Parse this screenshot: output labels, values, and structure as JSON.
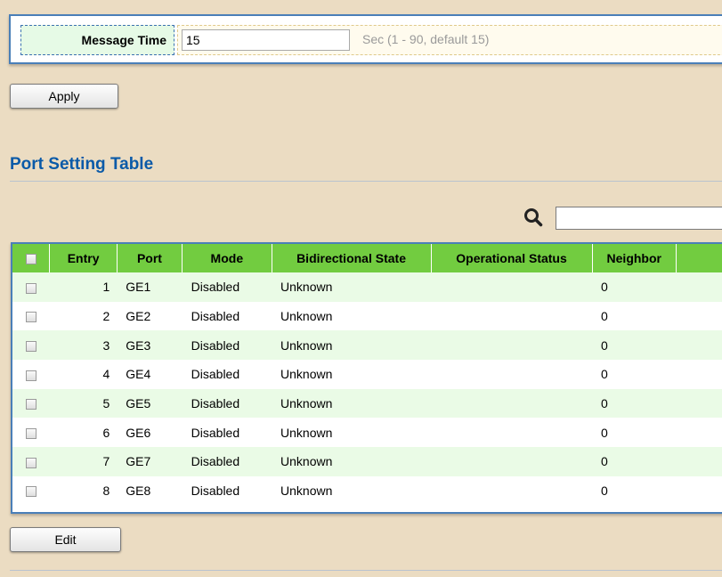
{
  "message_time": {
    "label": "Message Time",
    "value": "15",
    "hint": "Sec (1 - 90, default 15)"
  },
  "buttons": {
    "apply": "Apply",
    "edit": "Edit"
  },
  "port_table": {
    "title": "Port Setting Table",
    "search_value": "",
    "columns": [
      "Entry",
      "Port",
      "Mode",
      "Bidirectional State",
      "Operational Status",
      "Neighbor"
    ],
    "rows": [
      {
        "entry": "1",
        "port": "GE1",
        "mode": "Disabled",
        "bidirectional": "Unknown",
        "operational": "",
        "neighbor": "0"
      },
      {
        "entry": "2",
        "port": "GE2",
        "mode": "Disabled",
        "bidirectional": "Unknown",
        "operational": "",
        "neighbor": "0"
      },
      {
        "entry": "3",
        "port": "GE3",
        "mode": "Disabled",
        "bidirectional": "Unknown",
        "operational": "",
        "neighbor": "0"
      },
      {
        "entry": "4",
        "port": "GE4",
        "mode": "Disabled",
        "bidirectional": "Unknown",
        "operational": "",
        "neighbor": "0"
      },
      {
        "entry": "5",
        "port": "GE5",
        "mode": "Disabled",
        "bidirectional": "Unknown",
        "operational": "",
        "neighbor": "0"
      },
      {
        "entry": "6",
        "port": "GE6",
        "mode": "Disabled",
        "bidirectional": "Unknown",
        "operational": "",
        "neighbor": "0"
      },
      {
        "entry": "7",
        "port": "GE7",
        "mode": "Disabled",
        "bidirectional": "Unknown",
        "operational": "",
        "neighbor": "0"
      },
      {
        "entry": "8",
        "port": "GE8",
        "mode": "Disabled",
        "bidirectional": "Unknown",
        "operational": "",
        "neighbor": "0"
      }
    ]
  },
  "colors": {
    "header_green": "#72cc40",
    "row_stripe": "#eafbe6",
    "title_blue": "#0a5aa8",
    "panel_border": "#4a7fb8",
    "page_bg": "#ebdcc2"
  },
  "icons": {
    "search": "search-icon"
  }
}
